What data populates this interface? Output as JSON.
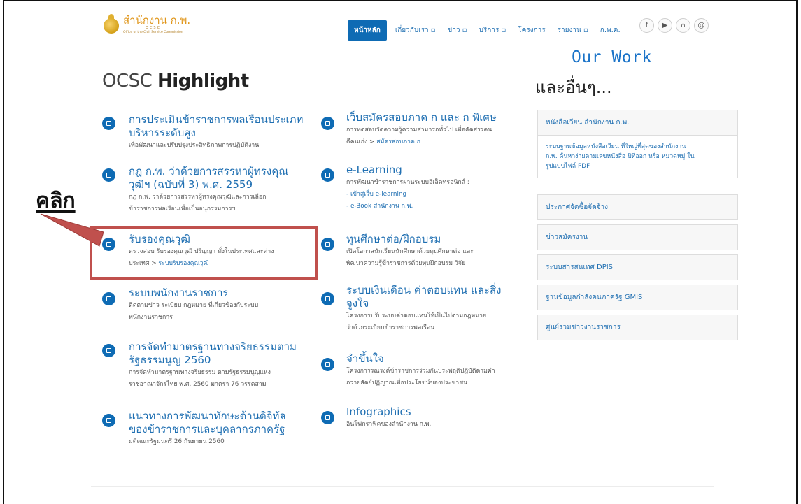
{
  "header": {
    "logo_title": "สำนักงาน ก.พ.",
    "logo_sub": "O C S C",
    "logo_sub2": "Office of the Civil Service Commission",
    "nav": [
      {
        "label": "หน้าหลัก",
        "active": true
      },
      {
        "label": "เกี่ยวกับเรา ▫"
      },
      {
        "label": "ข่าว ▫"
      },
      {
        "label": "บริการ ▫"
      },
      {
        "label": "โครงการ"
      },
      {
        "label": "รายงาน ▫"
      },
      {
        "label": "ก.พ.ค."
      }
    ],
    "social": [
      "f",
      "▶",
      "⌂",
      "@"
    ]
  },
  "main": {
    "title_light": "OCSC",
    "title_bold": "Highlight",
    "col1": [
      {
        "title": "การประเมินข้าราชการพลเรือนประเภท\nบริหารระดับสูง",
        "desc": "เพื่อพัฒนาและปรับปรุงประสิทธิภาพการปฏิบัติงาน"
      },
      {
        "title": "กฎ ก.พ. ว่าด้วยการสรรหาผู้ทรงคุณ\nวุฒิฯ (ฉบับที่ 3) พ.ศ. 2559",
        "desc": "กฎ ก.พ. ว่าด้วยการสรรหาผู้ทรงคุณวุฒิและการเลือก\nข้าราชการพลเรือนเพื่อเป็นอนุกรรมการฯ"
      },
      {
        "title": "รับรองคุณวุฒิ",
        "desc": "ตรวจสอบ รับรองคุณวุฒิ ปริญญา ทั้งในประเทศและต่าง\nประเทศ > ",
        "link": "ระบบรับรองคุณวุฒิ"
      },
      {
        "title": "ระบบพนักงานราชการ",
        "desc": "ติดตามข่าว ระเบียบ กฎหมาย ที่เกี่ยวข้องกับระบบ\nพนักงานราชการ"
      },
      {
        "title": "การจัดทำมาตรฐานทางจริยธรรมตาม\nรัฐธรรมนูญ 2560",
        "desc": "การจัดทำมาตรฐานทางจริยธรรม ตามรัฐธรรมนูญแห่ง\nราชอาณาจักรไทย พ.ศ. 2560 มาตรา 76 วรรคสาม"
      },
      {
        "title": "แนวทางการพัฒนาทักษะด้านดิจิทัล\nของข้าราชการและบุคลากรภาครัฐ",
        "desc": "มติคณะรัฐมนตรี 26 กันยายน 2560"
      }
    ],
    "col2": [
      {
        "title": "เว็บสมัครสอบภาค ก และ ก พิเศษ",
        "desc": "การทดสอบวัดความรู้ความสามารถทั่วไป เพื่อคัดสรรคน\nดีคนเก่ง > ",
        "link": "สมัครสอบภาค ก"
      },
      {
        "title": "e-Learning",
        "desc": "การพัฒนาข้าราชการผ่านระบบอิเล็คทรอนิกส์ :",
        "links": [
          "- เข้าสู่เว็บ e-learning",
          "- e-Book สำนักงาน ก.พ."
        ]
      },
      {
        "title": "ทุนศึกษาต่อ/ฝึกอบรม",
        "desc": "เปิดโอกาสนักเรียนนักศึกษาด้วยทุนศึกษาต่อ และ\nพัฒนาความรู้ข้าราชการด้วยทุนฝึกอบรม วิจัย"
      },
      {
        "title": "ระบบเงินเดือน ค่าตอบแทน และสิ่ง\nจูงใจ",
        "desc": "โครงการปรับระบบค่าตอบแทนให้เป็นไปตามกฎหมาย\nว่าด้วยระเบียบข้าราชการพลเรือน"
      },
      {
        "title": "จำขึ้นใจ",
        "desc": "โครงการรณรงค์ข้าราชการร่วมกันประพฤติปฏิบัติตามคำ\nถวายสัตย์ปฏิญาณเพื่อประโยชน์ของประชาชน"
      },
      {
        "title": "Infographics",
        "desc": "อินโฟกราฟิคของสำนักงาน ก.พ."
      }
    ]
  },
  "side": {
    "ourwork": "Our Work",
    "title": "และอื่นๆ...",
    "items": [
      {
        "label": "หนังสือเวียน สำนักงาน ก.พ.",
        "body": "ระบบฐานข้อมูลหนังสือเวียน ที่ใหญ่ที่สุดของสำนักงาน\nก.พ. ค้นหาง่ายตามเลขหนังสือ ปีที่ออก หรือ หมวดหมู่ ใน\nรูปแบบไฟล์ PDF"
      },
      {
        "label": "ประกาศจัดซื้อจัดจ้าง"
      },
      {
        "label": "ข่าวสมัครงาน"
      },
      {
        "label": "ระบบสารสนเทศ DPIS"
      },
      {
        "label": "ฐานข้อมูลกำลังคนภาครัฐ GMIS"
      },
      {
        "label": "ศูนย์รวมข่าวงานราชการ"
      }
    ]
  },
  "annotation": {
    "label": "คลิก",
    "color": "#c0504d"
  }
}
